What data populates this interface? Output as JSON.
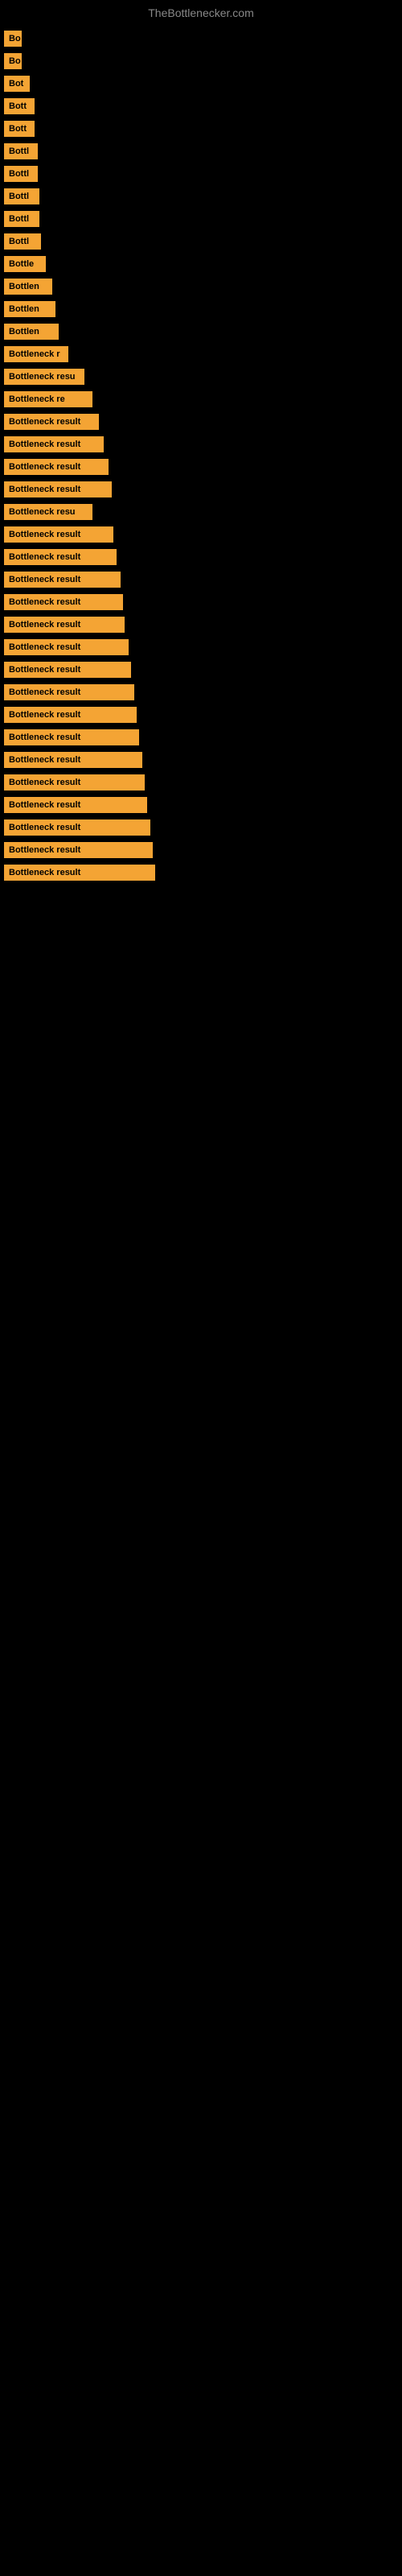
{
  "site": {
    "title": "TheBottlenecker.com"
  },
  "items": [
    {
      "id": 0,
      "label": "Bo",
      "full_text": "Bottleneck result"
    },
    {
      "id": 1,
      "label": "Bo",
      "full_text": "Bottleneck result"
    },
    {
      "id": 2,
      "label": "Bot",
      "full_text": "Bottleneck result"
    },
    {
      "id": 3,
      "label": "Bott",
      "full_text": "Bottleneck result"
    },
    {
      "id": 4,
      "label": "Bott",
      "full_text": "Bottleneck result"
    },
    {
      "id": 5,
      "label": "Bottl",
      "full_text": "Bottleneck result"
    },
    {
      "id": 6,
      "label": "Bottl",
      "full_text": "Bottleneck result"
    },
    {
      "id": 7,
      "label": "Bottl",
      "full_text": "Bottleneck result"
    },
    {
      "id": 8,
      "label": "Bottl",
      "full_text": "Bottleneck result"
    },
    {
      "id": 9,
      "label": "Bottl",
      "full_text": "Bottleneck result"
    },
    {
      "id": 10,
      "label": "Bottle",
      "full_text": "Bottleneck result"
    },
    {
      "id": 11,
      "label": "Bottlen",
      "full_text": "Bottleneck result"
    },
    {
      "id": 12,
      "label": "Bottlen",
      "full_text": "Bottleneck result"
    },
    {
      "id": 13,
      "label": "Bottlen",
      "full_text": "Bottleneck result"
    },
    {
      "id": 14,
      "label": "Bottleneck r",
      "full_text": "Bottleneck result"
    },
    {
      "id": 15,
      "label": "Bottleneck resu",
      "full_text": "Bottleneck result"
    },
    {
      "id": 16,
      "label": "Bottleneck re",
      "full_text": "Bottleneck result"
    },
    {
      "id": 17,
      "label": "Bottleneck result",
      "full_text": "Bottleneck result"
    },
    {
      "id": 18,
      "label": "Bottleneck result",
      "full_text": "Bottleneck result"
    },
    {
      "id": 19,
      "label": "Bottleneck result",
      "full_text": "Bottleneck result"
    },
    {
      "id": 20,
      "label": "Bottleneck result",
      "full_text": "Bottleneck result"
    },
    {
      "id": 21,
      "label": "Bottleneck resu",
      "full_text": "Bottleneck result"
    },
    {
      "id": 22,
      "label": "Bottleneck result",
      "full_text": "Bottleneck result"
    },
    {
      "id": 23,
      "label": "Bottleneck result",
      "full_text": "Bottleneck result"
    },
    {
      "id": 24,
      "label": "Bottleneck result",
      "full_text": "Bottleneck result"
    },
    {
      "id": 25,
      "label": "Bottleneck result",
      "full_text": "Bottleneck result"
    },
    {
      "id": 26,
      "label": "Bottleneck result",
      "full_text": "Bottleneck result"
    },
    {
      "id": 27,
      "label": "Bottleneck result",
      "full_text": "Bottleneck result"
    },
    {
      "id": 28,
      "label": "Bottleneck result",
      "full_text": "Bottleneck result"
    },
    {
      "id": 29,
      "label": "Bottleneck result",
      "full_text": "Bottleneck result"
    },
    {
      "id": 30,
      "label": "Bottleneck result",
      "full_text": "Bottleneck result"
    },
    {
      "id": 31,
      "label": "Bottleneck result",
      "full_text": "Bottleneck result"
    },
    {
      "id": 32,
      "label": "Bottleneck result",
      "full_text": "Bottleneck result"
    },
    {
      "id": 33,
      "label": "Bottleneck result",
      "full_text": "Bottleneck result"
    },
    {
      "id": 34,
      "label": "Bottleneck result",
      "full_text": "Bottleneck result"
    },
    {
      "id": 35,
      "label": "Bottleneck result",
      "full_text": "Bottleneck result"
    },
    {
      "id": 36,
      "label": "Bottleneck result",
      "full_text": "Bottleneck result"
    },
    {
      "id": 37,
      "label": "Bottleneck result",
      "full_text": "Bottleneck result"
    }
  ]
}
